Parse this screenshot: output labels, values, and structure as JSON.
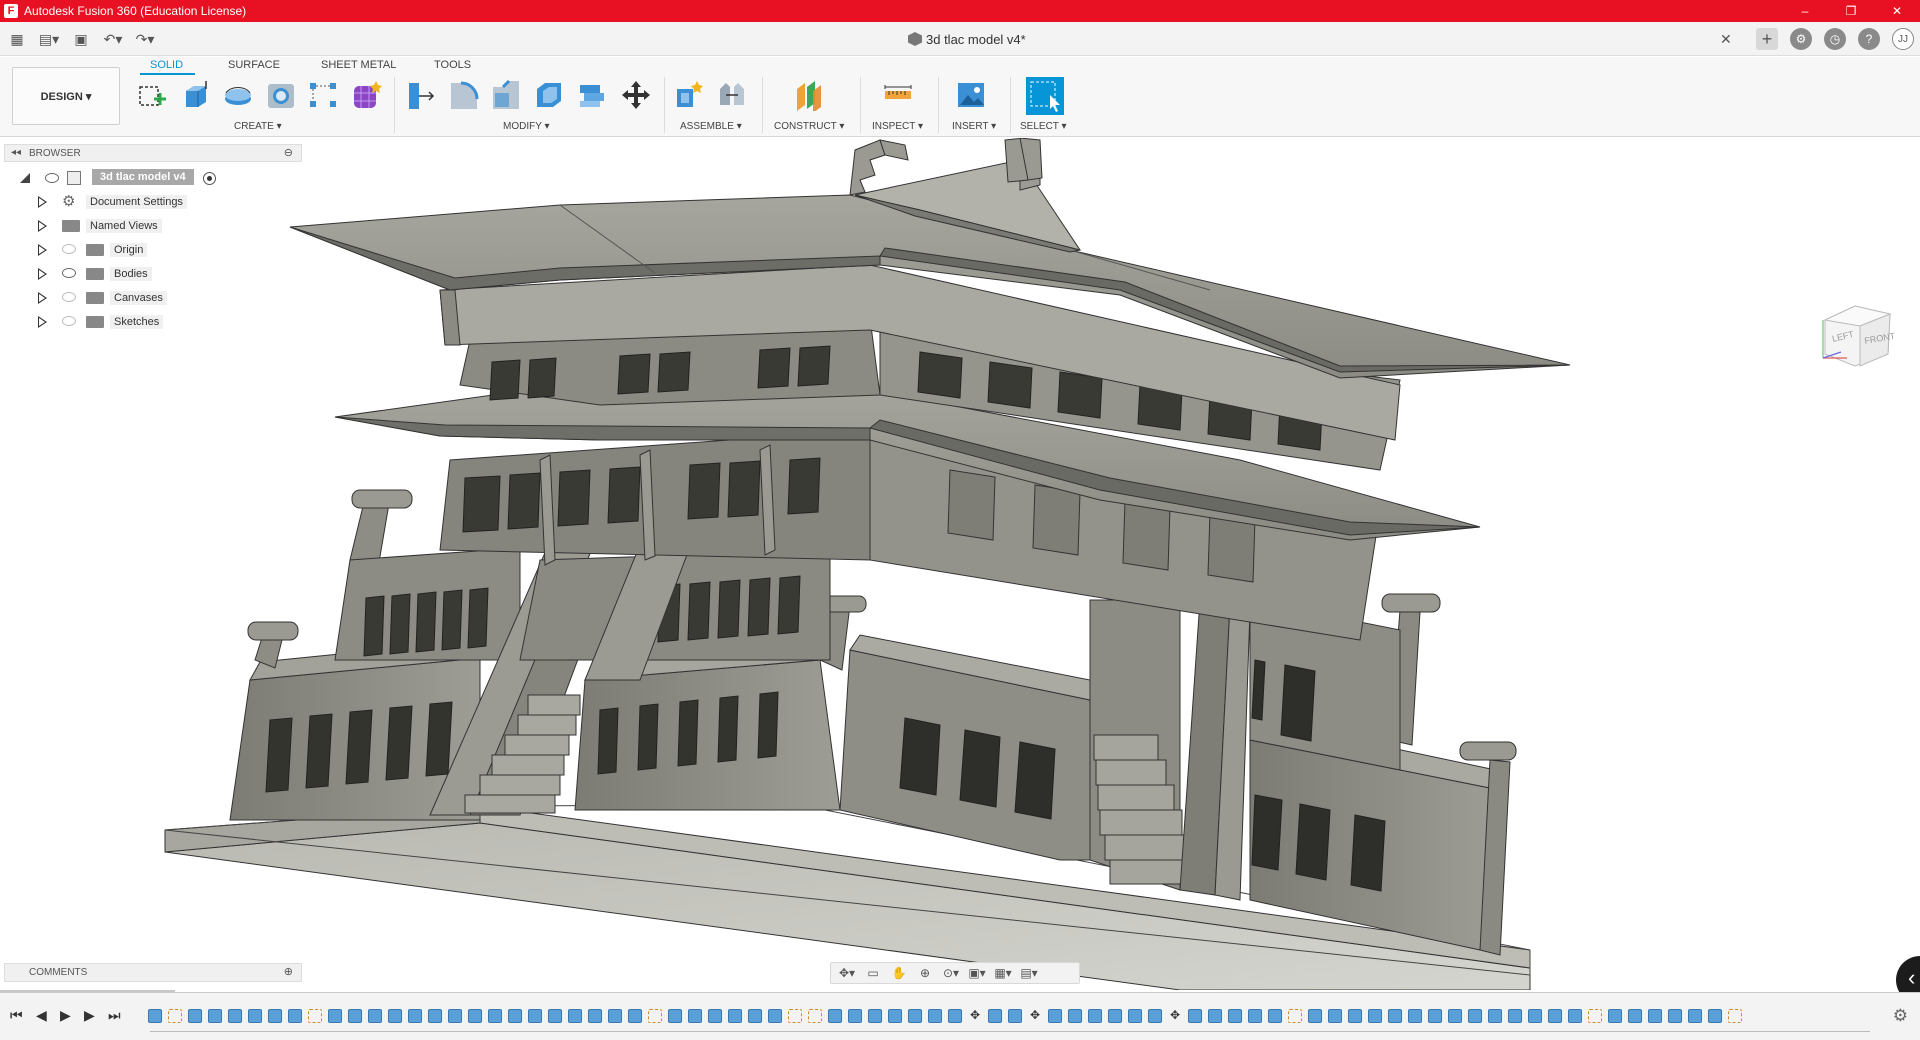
{
  "window": {
    "title": "Autodesk Fusion 360 (Education License)",
    "app_icon_letter": "F",
    "minimize": "–",
    "restore": "❐",
    "close": "✕"
  },
  "tabbar": {
    "doc_title": "3d tlac model v4*",
    "close_glyph": "✕",
    "new_tab": "+",
    "user_initials": "JJ",
    "qa_icons": [
      "grid-icon",
      "file-icon",
      "save-icon",
      "undo-icon",
      "redo-icon"
    ]
  },
  "ribbon": {
    "workspace": "DESIGN ▾",
    "tabs": [
      "SOLID",
      "SURFACE",
      "SHEET METAL",
      "TOOLS"
    ],
    "active_tab": "SOLID",
    "groups": {
      "create": "CREATE ▾",
      "modify": "MODIFY ▾",
      "assemble": "ASSEMBLE ▾",
      "construct": "CONSTRUCT ▾",
      "inspect": "INSPECT ▾",
      "insert": "INSERT ▾",
      "select": "SELECT ▾"
    }
  },
  "browser": {
    "header": "BROWSER",
    "collapse_glyph": "◂◂",
    "pin_glyph": "⊖",
    "root": "3d tlac model v4",
    "items": [
      {
        "label": "Document Settings",
        "icon": "gear-icon"
      },
      {
        "label": "Named Views",
        "icon": "folder-icon"
      },
      {
        "label": "Origin",
        "icon": "folder-icon"
      },
      {
        "label": "Bodies",
        "icon": "folder-icon"
      },
      {
        "label": "Canvases",
        "icon": "folder-icon"
      },
      {
        "label": "Sketches",
        "icon": "folder-icon"
      }
    ]
  },
  "viewcube": {
    "left": "LEFT",
    "front": "FRONT"
  },
  "comments": {
    "label": "COMMENTS",
    "add_glyph": "⊕"
  },
  "colors": {
    "titlebar": "#e81123",
    "accent": "#0696d7",
    "model_face": "#8f8f88",
    "model_light": "#b8b8b1",
    "model_dark": "#4e4e49"
  }
}
